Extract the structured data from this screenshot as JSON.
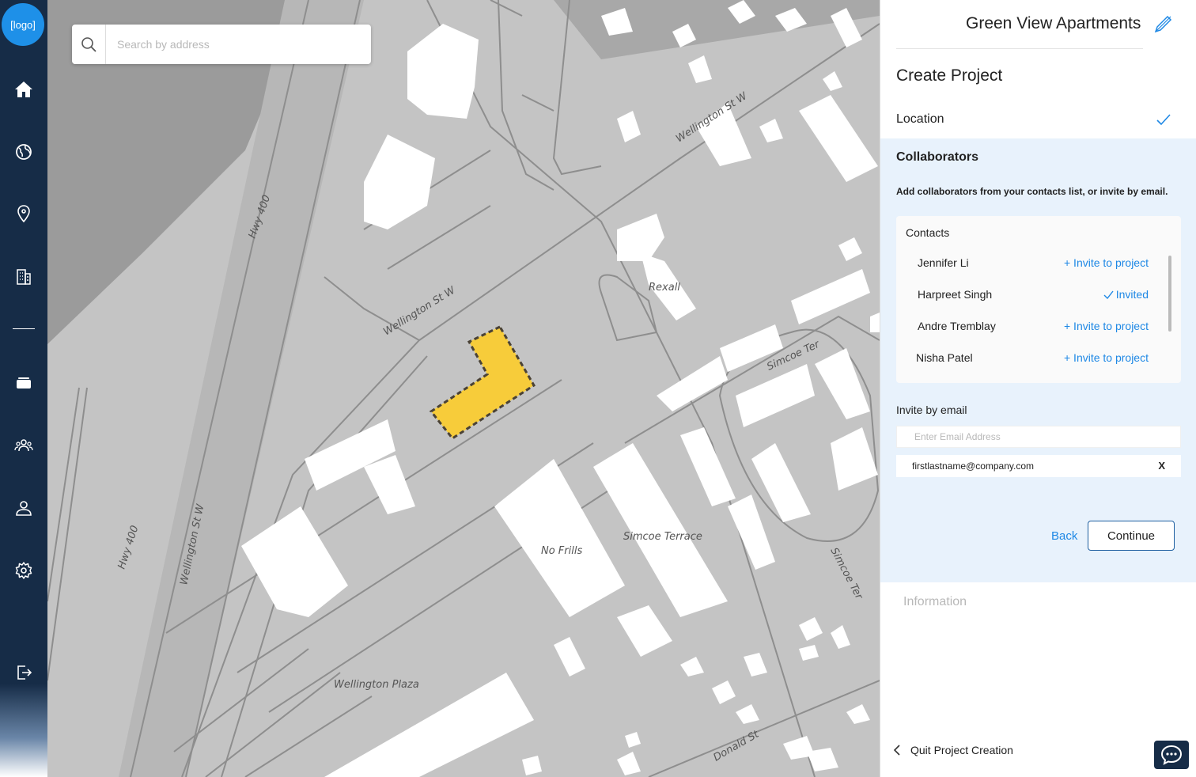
{
  "sidebar": {
    "logo": "[logo]",
    "items": [
      {
        "icon": "home-icon"
      },
      {
        "icon": "globe-icon"
      },
      {
        "icon": "location-pin-icon"
      },
      {
        "icon": "building-icon"
      },
      {
        "icon": "layers-icon"
      },
      {
        "icon": "users-icon"
      },
      {
        "icon": "user-icon"
      },
      {
        "icon": "gear-icon"
      },
      {
        "icon": "logout-icon"
      }
    ]
  },
  "search": {
    "placeholder": "Search by address",
    "value": ""
  },
  "map": {
    "labels": {
      "hwy400_top": "Hwy 400",
      "hwy400_bottom": "Hwy 400",
      "wellington_upper": "Wellington St W",
      "wellington_mid": "Wellington St W",
      "wellington_left": "Wellington St W",
      "rexall": "Rexall",
      "simcoe_ter": "Simcoe Ter",
      "simcoe_ter_right": "Simcoe Ter",
      "simcoe_terrace": "Simcoe Terrace",
      "no_frills": "No Frills",
      "wellington_plaza": "Wellington Plaza",
      "donald_st": "Donald St"
    },
    "selection_color": "#f7cc3a"
  },
  "panel": {
    "project_title": "Green View Apartments",
    "heading": "Create Project",
    "steps": {
      "location": "Location",
      "collaborators": "Collaborators",
      "information": "Information"
    },
    "collaborators": {
      "description": "Add collaborators from your contacts list, or invite by email.",
      "contacts_title": "Contacts",
      "contacts": [
        {
          "name": "Jennifer Li",
          "action": "+ Invite to project"
        },
        {
          "name": "Harpreet Singh",
          "action": "Invited"
        },
        {
          "name": "Andre Tremblay",
          "action": "+ Invite to project"
        },
        {
          "name": "Nisha Patel",
          "action": "+ Invite to project"
        }
      ],
      "invite_label": "Invite by email",
      "email_placeholder": "Enter Email Address",
      "email_chip": "firstlastname@company.com",
      "email_chip_remove": "X",
      "back": "Back",
      "continue": "Continue"
    },
    "quit": "Quit Project Creation"
  },
  "colors": {
    "sidebar": "#162c47",
    "accent": "#1e88e5",
    "panel_highlight": "#e8f2fc"
  }
}
